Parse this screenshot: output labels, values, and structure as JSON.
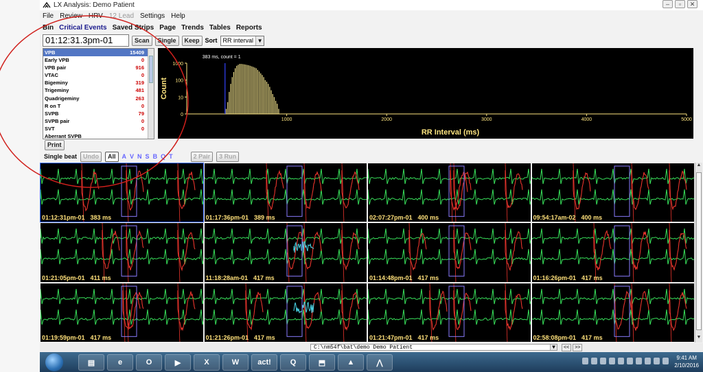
{
  "window": {
    "title": "LX Analysis: Demo Patient"
  },
  "menu": [
    {
      "label": "File",
      "enabled": true
    },
    {
      "label": "Review",
      "enabled": true
    },
    {
      "label": "HRV",
      "enabled": true
    },
    {
      "label": "12 Lead",
      "enabled": false
    },
    {
      "label": "Settings",
      "enabled": true
    },
    {
      "label": "Help",
      "enabled": true
    }
  ],
  "tabs": [
    {
      "label": "Bin",
      "active": false
    },
    {
      "label": "Critical Events",
      "active": true
    },
    {
      "label": "Saved Strips",
      "active": false
    },
    {
      "label": "Page",
      "active": false
    },
    {
      "label": "Trends",
      "active": false
    },
    {
      "label": "Tables",
      "active": false
    },
    {
      "label": "Reports",
      "active": false
    }
  ],
  "toolbar": {
    "time_value": "01:12:31.3pm-01",
    "scan_label": "Scan",
    "single_label": "Single",
    "keep_label": "Keep",
    "sort_label": "Sort",
    "sort_value": "RR interval"
  },
  "events": [
    {
      "name": "VPB",
      "count": "15409",
      "selected": true
    },
    {
      "name": "Early VPB",
      "count": "0"
    },
    {
      "name": "VPB pair",
      "count": "916"
    },
    {
      "name": "VTAC",
      "count": "0"
    },
    {
      "name": "Bigeminy",
      "count": "319"
    },
    {
      "name": "Trigeminy",
      "count": "481"
    },
    {
      "name": "Quadrigeminy",
      "count": "263"
    },
    {
      "name": "R on T",
      "count": "0"
    },
    {
      "name": "SVPB",
      "count": "79"
    },
    {
      "name": "SVPB pair",
      "count": "0"
    },
    {
      "name": "SVT",
      "count": "0"
    },
    {
      "name": "Aberrant SVPB",
      "count": ""
    }
  ],
  "print_label": "Print",
  "beat_controls": {
    "label": "Single beat",
    "undo": "Undo",
    "all": "All",
    "classes": [
      "A",
      "V",
      "N",
      "S",
      "B",
      "Q",
      "T"
    ],
    "pair": "2 Pair",
    "run": "3 Run"
  },
  "histogram": {
    "annotation": "383 ms, count = 1",
    "ylabel": "Count",
    "xlabel": "RR Interval (ms)",
    "colors": {
      "bars": "#f0e08a",
      "axes": "#ffe680",
      "cursor": "#3344ff",
      "background": "#000000"
    }
  },
  "chart_data": {
    "type": "bar",
    "x_scale": "linear",
    "y_scale": "log",
    "xlim": [
      0,
      5000
    ],
    "ylim": [
      1,
      1000
    ],
    "x_ticks": [
      "1000",
      "2000",
      "3000",
      "4000",
      "5000"
    ],
    "y_ticks": [
      "1000",
      "100",
      "10",
      "0"
    ],
    "xlabel": "RR Interval (ms)",
    "ylabel": "Count",
    "annotation": "383 ms, count = 1",
    "cursor_x": 383,
    "x": [
      395,
      410,
      425,
      440,
      455,
      470,
      485,
      500,
      515,
      530,
      545,
      560,
      575,
      590,
      605,
      620,
      635,
      650,
      665,
      680,
      695,
      710,
      725,
      740,
      755,
      770,
      785,
      800,
      815,
      830,
      845,
      860,
      875,
      890,
      905,
      920
    ],
    "values": [
      2,
      5,
      20,
      60,
      150,
      300,
      500,
      700,
      800,
      900,
      900,
      880,
      850,
      820,
      780,
      750,
      700,
      650,
      600,
      550,
      500,
      400,
      320,
      250,
      200,
      150,
      100,
      80,
      60,
      40,
      25,
      15,
      10,
      6,
      4,
      2
    ]
  },
  "strips": [
    {
      "time": "01:12:31pm-01",
      "ms": "383 ms",
      "selected": true
    },
    {
      "time": "01:17:36pm-01",
      "ms": "389 ms"
    },
    {
      "time": "02:07:27pm-01",
      "ms": "400 ms"
    },
    {
      "time": "09:54:17am-02",
      "ms": "400 ms"
    },
    {
      "time": "01:21:05pm-01",
      "ms": "411 ms"
    },
    {
      "time": "11:18:28am-01",
      "ms": "417 ms"
    },
    {
      "time": "01:14:48pm-01",
      "ms": "417 ms"
    },
    {
      "time": "01:16:26pm-01",
      "ms": "417 ms"
    },
    {
      "time": "01:19:59pm-01",
      "ms": "417 ms"
    },
    {
      "time": "01:21:26pm-01",
      "ms": "417 ms"
    },
    {
      "time": "01:21:47pm-01",
      "ms": "417 ms"
    },
    {
      "time": "02:58:08pm-01",
      "ms": "417 ms"
    }
  ],
  "ecg_colors": {
    "normal": "#38e05a",
    "ventricular": "#e8342c",
    "supra": "#4ad7e8",
    "marker": "#8a7cff"
  },
  "status": {
    "path": "C:\\nm54f\\bat\\demo Demo Patient",
    "prev": "<<",
    "next": ">>"
  },
  "taskbar": {
    "apps": [
      "explorer",
      "ie",
      "outlook",
      "media",
      "excel",
      "word",
      "act!",
      "q",
      "pdf",
      "lx"
    ],
    "time": "9:41 AM",
    "date": "2/10/2016"
  }
}
